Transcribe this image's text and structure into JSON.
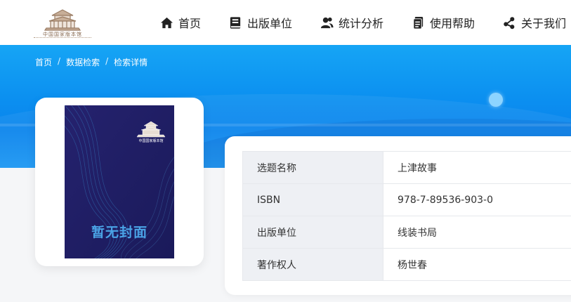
{
  "header": {
    "logo_text": "中国国家版本馆",
    "nav": [
      {
        "label": "首页",
        "icon": "home-icon"
      },
      {
        "label": "出版单位",
        "icon": "book-icon"
      },
      {
        "label": "统计分析",
        "icon": "users-icon"
      },
      {
        "label": "使用帮助",
        "icon": "document-icon"
      },
      {
        "label": "关于我们",
        "icon": "share-nodes-icon"
      }
    ]
  },
  "breadcrumb": {
    "items": [
      "首页",
      "数据检索",
      "检索详情"
    ],
    "separator": "/"
  },
  "cover": {
    "placeholder_text": "暂无封面",
    "logo_text": "中国国家版本馆"
  },
  "details": [
    {
      "label": "选题名称",
      "value": "上津故事"
    },
    {
      "label": "ISBN",
      "value": "978-7-89536-903-0"
    },
    {
      "label": "出版单位",
      "value": "线装书局"
    },
    {
      "label": "著作权人",
      "value": "杨世春"
    }
  ],
  "colors": {
    "hero_blue": "#0b8ff0",
    "cover_bg": "#1f1f66",
    "cover_text": "#4aa3e6",
    "logo_brown": "#8a6d55"
  }
}
